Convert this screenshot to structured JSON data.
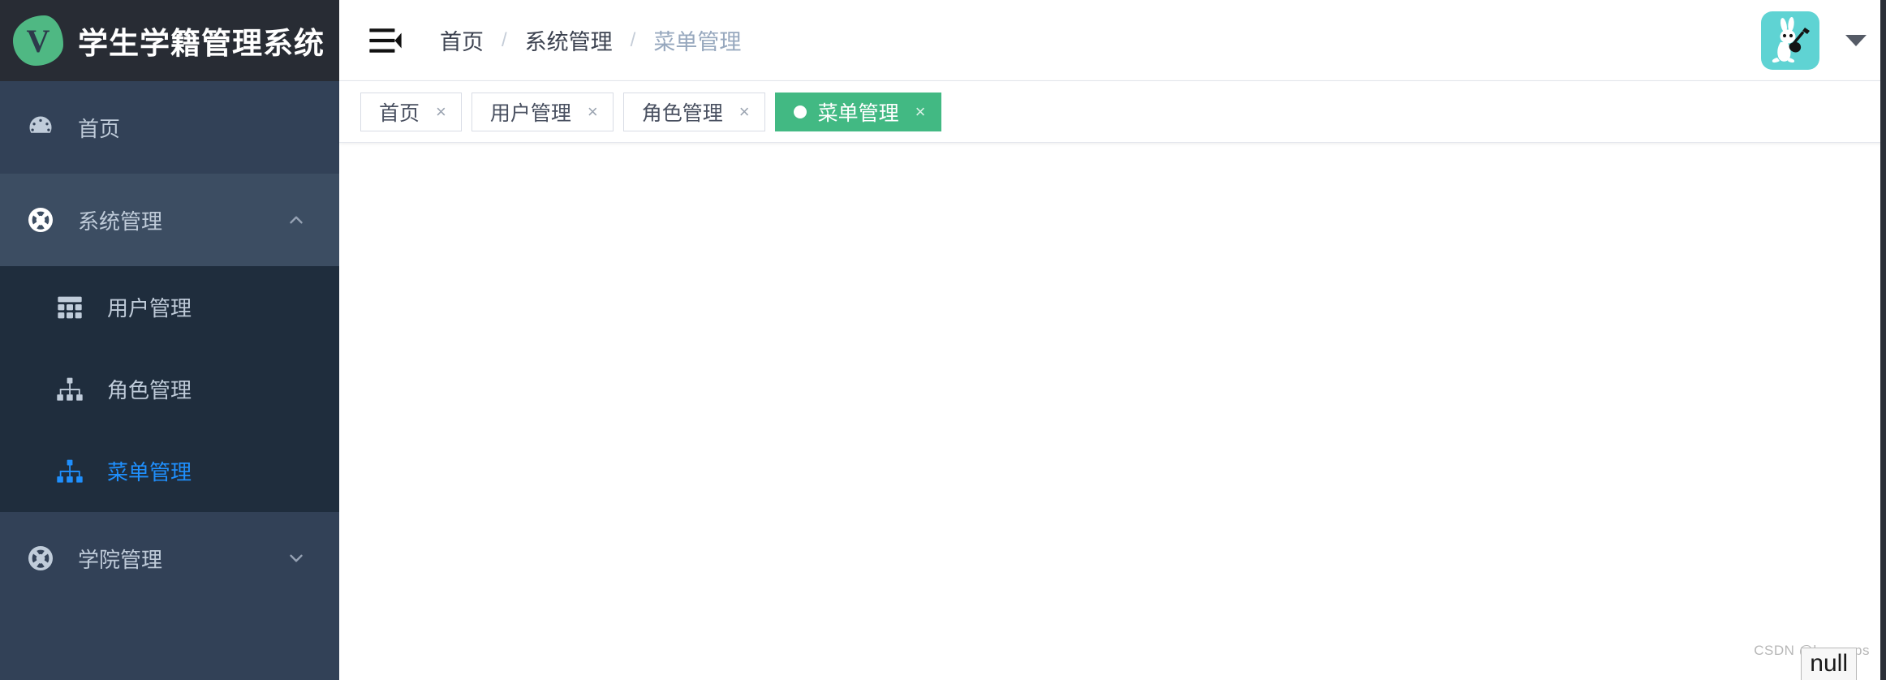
{
  "app": {
    "title": "学生学籍管理系统",
    "logo_letter": "V",
    "logo_color": "#4fb883",
    "accent_color": "#42b983",
    "active_link_color": "#1f8ffd",
    "sidebar_bg": "#324157",
    "sidebar_header_bg": "#282c34",
    "submenu_bg": "#1f2d3d"
  },
  "sidebar": {
    "items": [
      {
        "label": "首页",
        "icon": "dashboard-icon",
        "type": "link",
        "active": false
      },
      {
        "label": "系统管理",
        "icon": "system-gear-icon",
        "type": "submenu",
        "expanded": true,
        "arrow": "chevron-up-icon",
        "children": [
          {
            "label": "用户管理",
            "icon": "table-grid-icon",
            "active": false
          },
          {
            "label": "角色管理",
            "icon": "sitemap-icon",
            "active": false
          },
          {
            "label": "菜单管理",
            "icon": "sitemap-icon",
            "active": true
          }
        ]
      },
      {
        "label": "学院管理",
        "icon": "system-gear-icon",
        "type": "submenu",
        "expanded": false,
        "arrow": "chevron-down-icon",
        "children": []
      }
    ]
  },
  "topbar": {
    "menu_toggle_icon": "menu-fold-icon",
    "breadcrumb": [
      {
        "label": "首页",
        "current": false
      },
      {
        "label": "系统管理",
        "current": false
      },
      {
        "label": "菜单管理",
        "current": true
      }
    ],
    "breadcrumb_separator": "/",
    "avatar": {
      "icon": "rabbit-guitar-avatar",
      "background": "#5fd3d3"
    },
    "dropdown_icon": "caret-down-icon"
  },
  "tabs": [
    {
      "label": "首页",
      "active": false,
      "close": "×"
    },
    {
      "label": "用户管理",
      "active": false,
      "close": "×"
    },
    {
      "label": "角色管理",
      "active": false,
      "close": "×"
    },
    {
      "label": "菜单管理",
      "active": true,
      "close": "×"
    }
  ],
  "content": {
    "null_text": "null",
    "watermark": "CSDN @heromps"
  }
}
